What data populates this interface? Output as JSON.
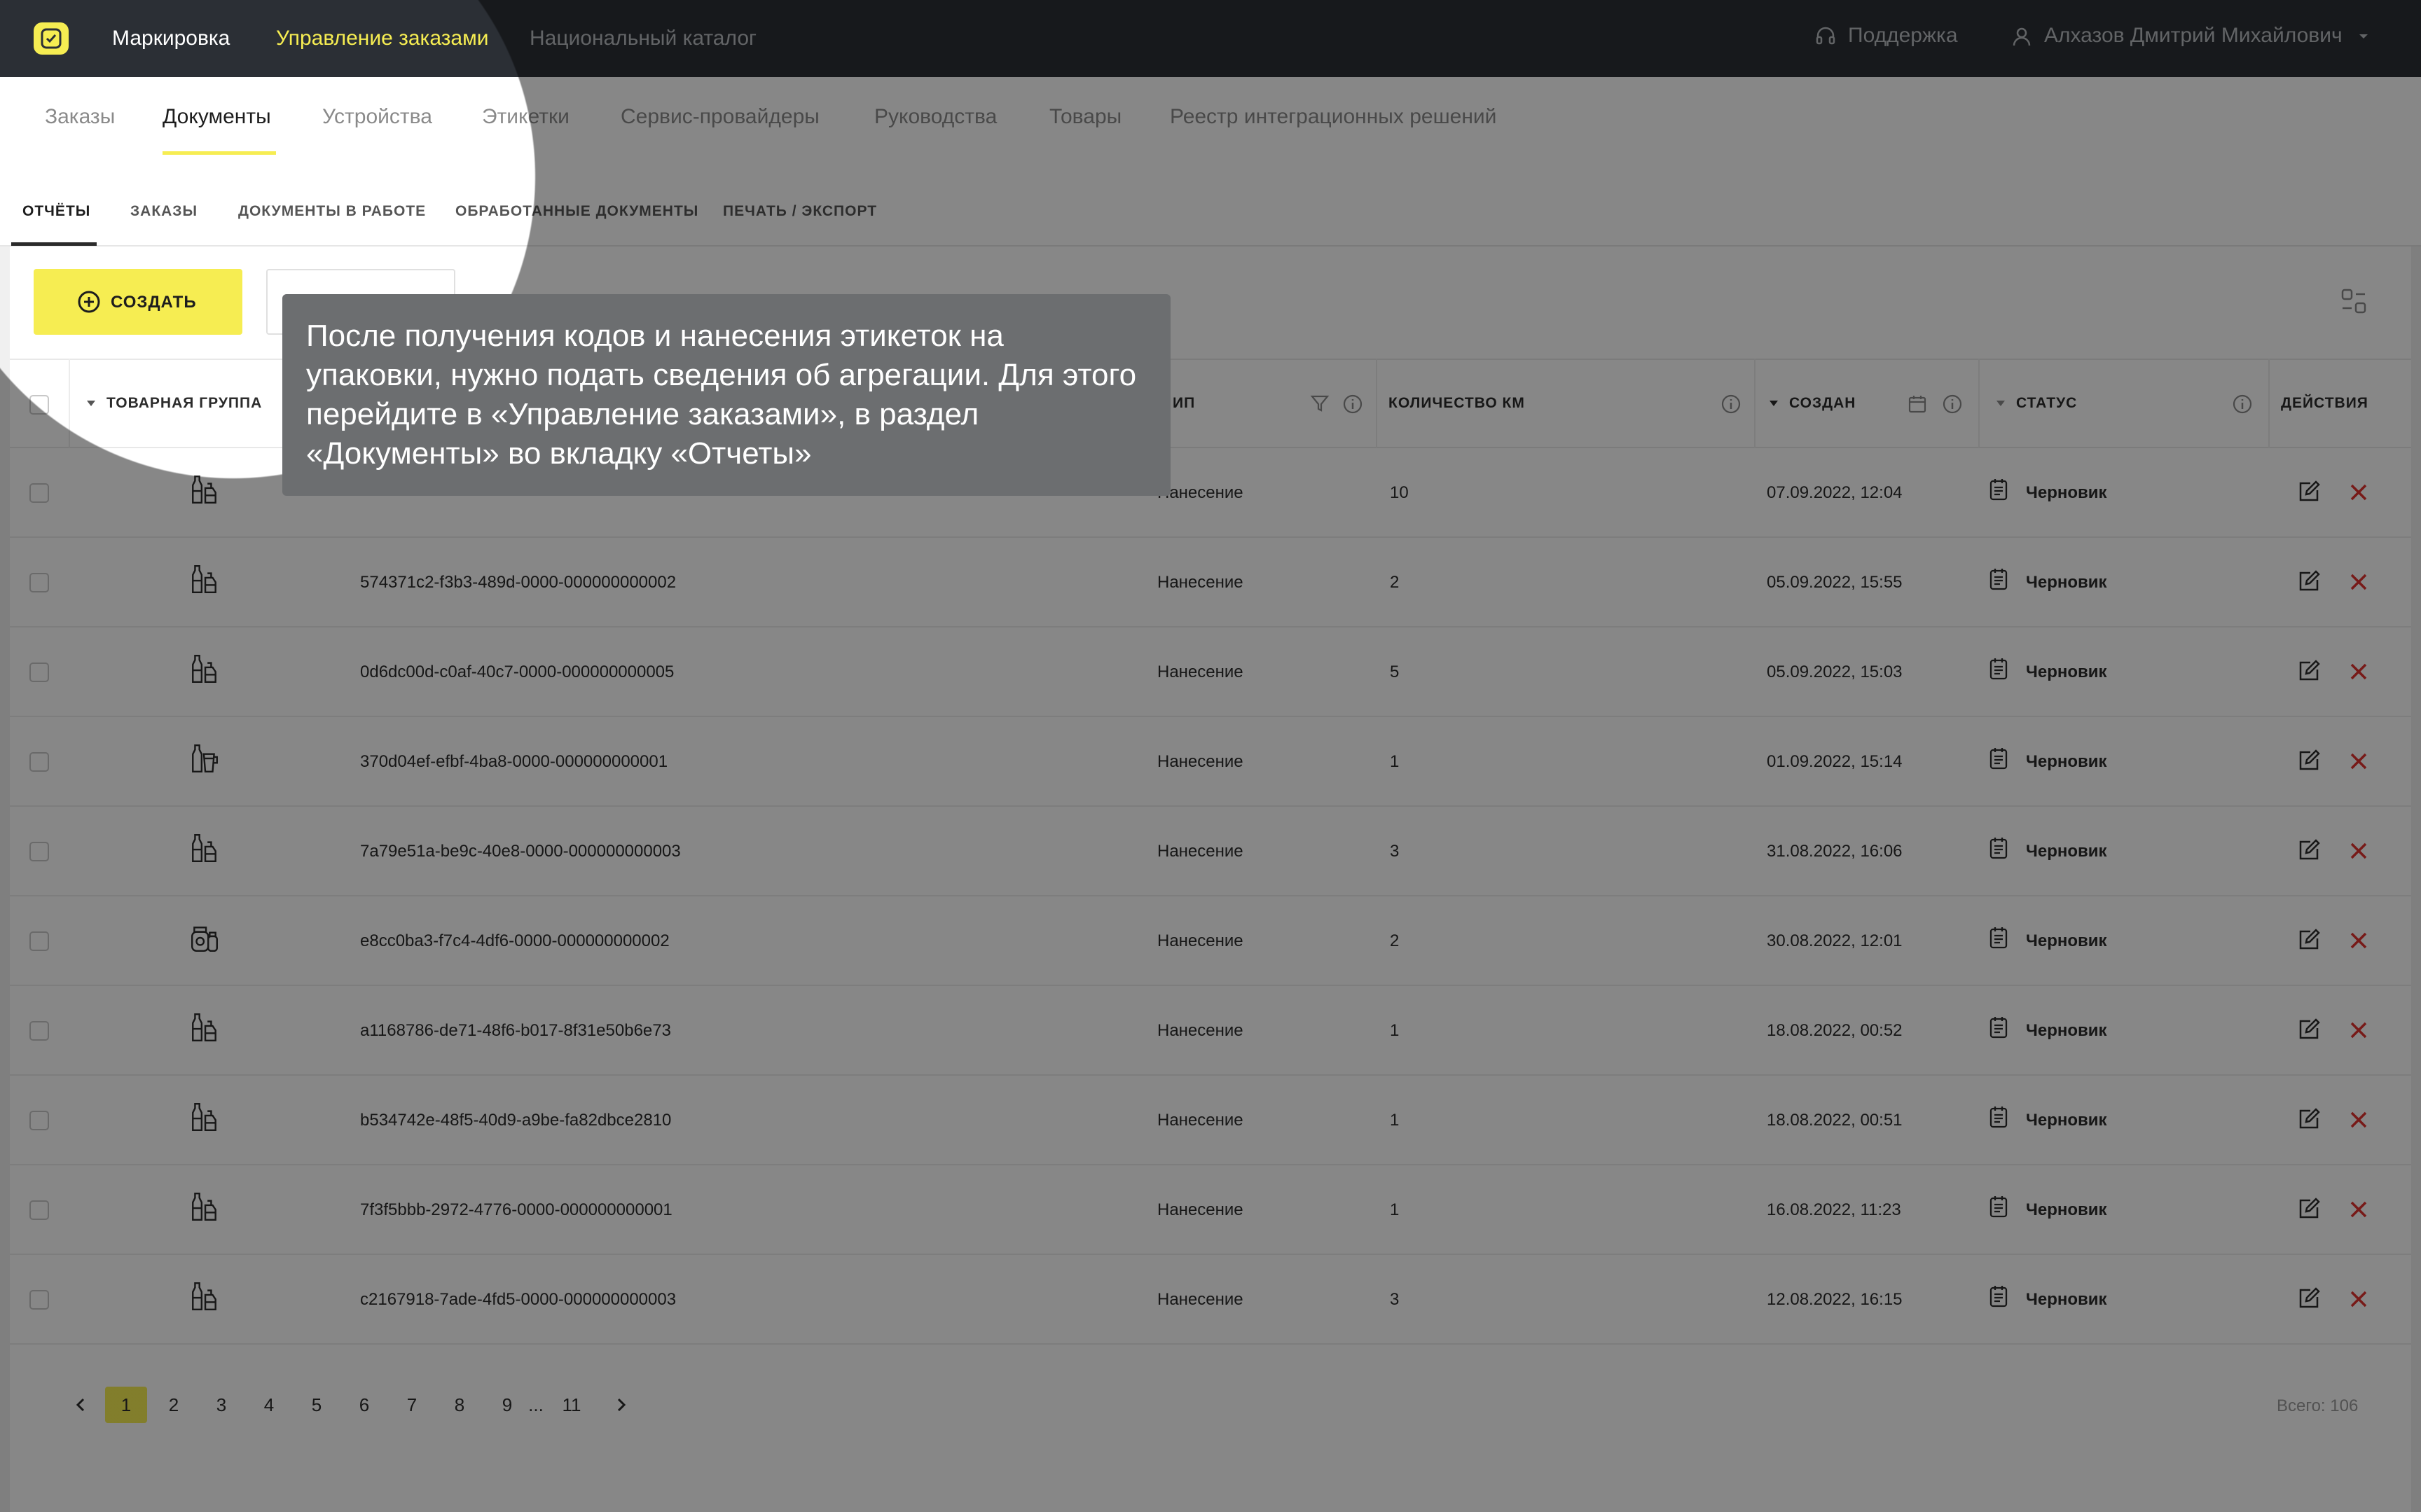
{
  "topnav": {
    "items": [
      "Маркировка",
      "Управление заказами",
      "Национальный каталог"
    ],
    "active_index": 1,
    "support": "Поддержка",
    "user": "Алхазов Дмитрий Михайлович"
  },
  "subnav": {
    "items": [
      "Заказы",
      "Документы",
      "Устройства",
      "Этикетки",
      "Сервис-провайдеры",
      "Руководства",
      "Товары",
      "Реестр интеграционных решений"
    ],
    "active_index": 1
  },
  "tabs": {
    "items": [
      "ОТЧЁТЫ",
      "ЗАКАЗЫ",
      "ДОКУМЕНТЫ В РАБОТЕ",
      "ОБРАБОТАННЫЕ ДОКУМЕНТЫ",
      "ПЕЧАТЬ / ЭКСПОРТ"
    ],
    "active_index": 0
  },
  "toolbar": {
    "create_label": "СОЗДАТЬ"
  },
  "table": {
    "headers": {
      "group": "ТОВАРНАЯ ГРУППА",
      "type": "ИП",
      "count": "КОЛИЧЕСТВО КМ",
      "created": "СОЗДАН",
      "status": "СТАТУС",
      "actions": "ДЕЙСТВИЯ"
    },
    "rows": [
      {
        "id": "",
        "type": "Нанесение",
        "count": "10",
        "created": "07.09.2022, 12:04",
        "status": "Черновик",
        "icon": "bottles-icon"
      },
      {
        "id": "574371c2-f3b3-489d-0000-000000000002",
        "type": "Нанесение",
        "count": "2",
        "created": "05.09.2022, 15:55",
        "status": "Черновик",
        "icon": "bottles-icon"
      },
      {
        "id": "0d6dc00d-c0af-40c7-0000-000000000005",
        "type": "Нанесение",
        "count": "5",
        "created": "05.09.2022, 15:03",
        "status": "Черновик",
        "icon": "bottles-icon"
      },
      {
        "id": "370d04ef-efbf-4ba8-0000-000000000001",
        "type": "Нанесение",
        "count": "1",
        "created": "01.09.2022, 15:14",
        "status": "Черновик",
        "icon": "beer-icon"
      },
      {
        "id": "7a79e51a-be9c-40e8-0000-000000000003",
        "type": "Нанесение",
        "count": "3",
        "created": "31.08.2022, 16:06",
        "status": "Черновик",
        "icon": "bottles-icon"
      },
      {
        "id": "e8cc0ba3-f7c4-4df6-0000-000000000002",
        "type": "Нанесение",
        "count": "2",
        "created": "30.08.2022, 12:01",
        "status": "Черновик",
        "icon": "jars-icon"
      },
      {
        "id": "a1168786-de71-48f6-b017-8f31e50b6e73",
        "type": "Нанесение",
        "count": "1",
        "created": "18.08.2022, 00:52",
        "status": "Черновик",
        "icon": "bottles-icon"
      },
      {
        "id": "b534742e-48f5-40d9-a9be-fa82dbce2810",
        "type": "Нанесение",
        "count": "1",
        "created": "18.08.2022, 00:51",
        "status": "Черновик",
        "icon": "bottles-icon"
      },
      {
        "id": "7f3f5bbb-2972-4776-0000-000000000001",
        "type": "Нанесение",
        "count": "1",
        "created": "16.08.2022, 11:23",
        "status": "Черновик",
        "icon": "bottles-icon"
      },
      {
        "id": "c2167918-7ade-4fd5-0000-000000000003",
        "type": "Нанесение",
        "count": "3",
        "created": "12.08.2022, 16:15",
        "status": "Черновик",
        "icon": "bottles-icon"
      }
    ]
  },
  "pagination": {
    "pages": [
      "1",
      "2",
      "3",
      "4",
      "5",
      "6",
      "7",
      "8",
      "9",
      "...",
      "11"
    ],
    "current": "1",
    "total": "Всего: 106"
  },
  "tooltip": {
    "text": "После получения кодов и нанесения этикеток на упаковки, нужно подать сведения об агрегации. Для этого перейдите в «Управление заказами», в раздел «Документы» во вкладку «Отчеты»"
  },
  "colors": {
    "accent": "#f6ed52",
    "topbar": "#2b2f35",
    "delete": "#e0322d",
    "tooltip": "#6c6e70"
  }
}
